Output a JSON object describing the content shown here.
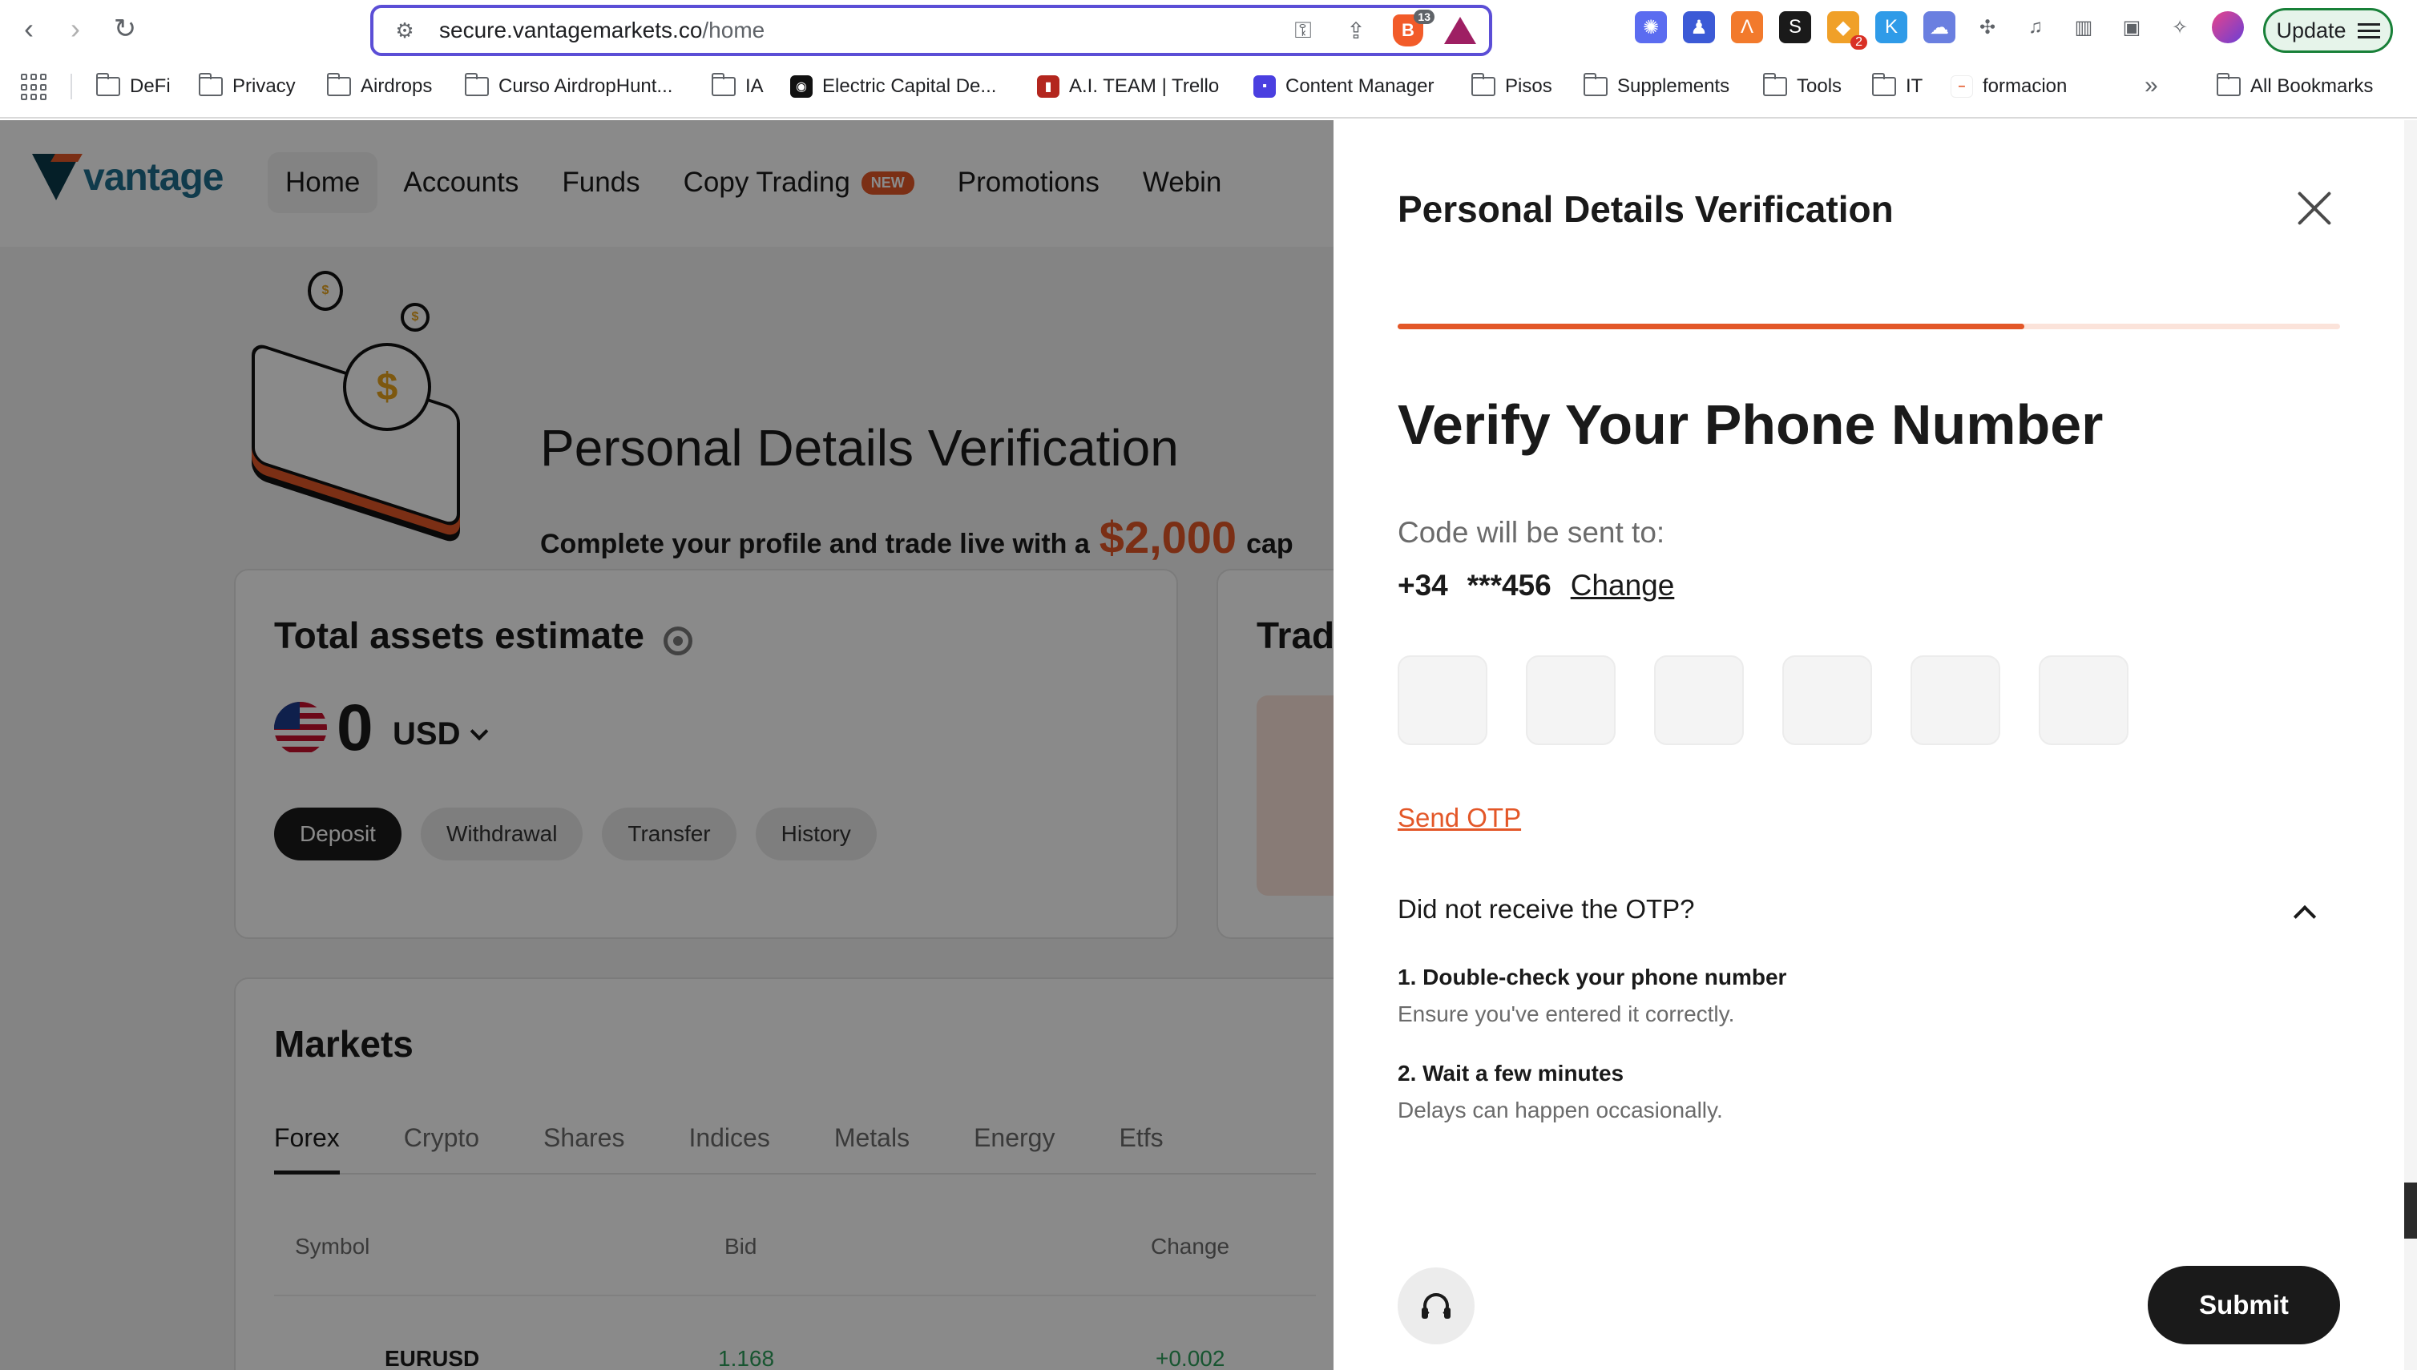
{
  "browser": {
    "url_host": "secure.vantagemarkets.co",
    "url_path": "/home",
    "brave_badge": "13",
    "ext_badge": "2",
    "update_label": "Update",
    "bookmarks": [
      {
        "label": "DeFi",
        "type": "folder"
      },
      {
        "label": "Privacy",
        "type": "folder"
      },
      {
        "label": "Airdrops",
        "type": "folder"
      },
      {
        "label": "Curso AirdropHunt...",
        "type": "folder"
      },
      {
        "label": "IA",
        "type": "folder"
      },
      {
        "label": "Electric Capital De...",
        "type": "site"
      },
      {
        "label": "A.I. TEAM | Trello",
        "type": "site"
      },
      {
        "label": "Content Manager",
        "type": "site"
      },
      {
        "label": "Pisos",
        "type": "folder"
      },
      {
        "label": "Supplements",
        "type": "folder"
      },
      {
        "label": "Tools",
        "type": "folder"
      },
      {
        "label": "IT",
        "type": "folder"
      },
      {
        "label": "formacion",
        "type": "site"
      }
    ],
    "all_bookmarks": "All Bookmarks"
  },
  "site": {
    "logo": "vantage",
    "nav": [
      "Home",
      "Accounts",
      "Funds",
      "Copy Trading",
      "Promotions",
      "Webin"
    ],
    "new_badge": "NEW",
    "banner_title": "Personal Details Verification",
    "banner_sub_pre": "Complete your profile and trade live with a",
    "banner_amount": "$2,000",
    "banner_sub_post": "cap",
    "assets_title": "Total assets estimate",
    "balance": "0",
    "currency": "USD",
    "actions": [
      "Deposit",
      "Withdrawal",
      "Transfer",
      "History"
    ],
    "trade_title": "Trad",
    "markets_title": "Markets",
    "market_tabs": [
      "Forex",
      "Crypto",
      "Shares",
      "Indices",
      "Metals",
      "Energy",
      "Etfs"
    ],
    "market_headers": [
      "Symbol",
      "Bid",
      "Change"
    ],
    "market_row": {
      "symbol": "EURUSD",
      "bid": "1.168",
      "change": "+0.002"
    }
  },
  "drawer": {
    "title": "Personal Details Verification",
    "progress": 0.665,
    "heading": "Verify Your Phone Number",
    "code_label": "Code will be sent to:",
    "country_code": "+34",
    "masked_number": "***456",
    "change_label": "Change",
    "otp_boxes": 6,
    "send_otp": "Send OTP",
    "faq_question": "Did not receive the OTP?",
    "faq_items": [
      {
        "title": "1. Double-check your phone number",
        "desc": "Ensure you've entered it correctly."
      },
      {
        "title": "2. Wait a few minutes",
        "desc": "Delays can happen occasionally."
      }
    ],
    "submit_label": "Submit"
  },
  "colors": {
    "accent": "#e35728",
    "dark": "#1a1a1a",
    "overlay": "rgba(0,0,0,0.46)"
  }
}
